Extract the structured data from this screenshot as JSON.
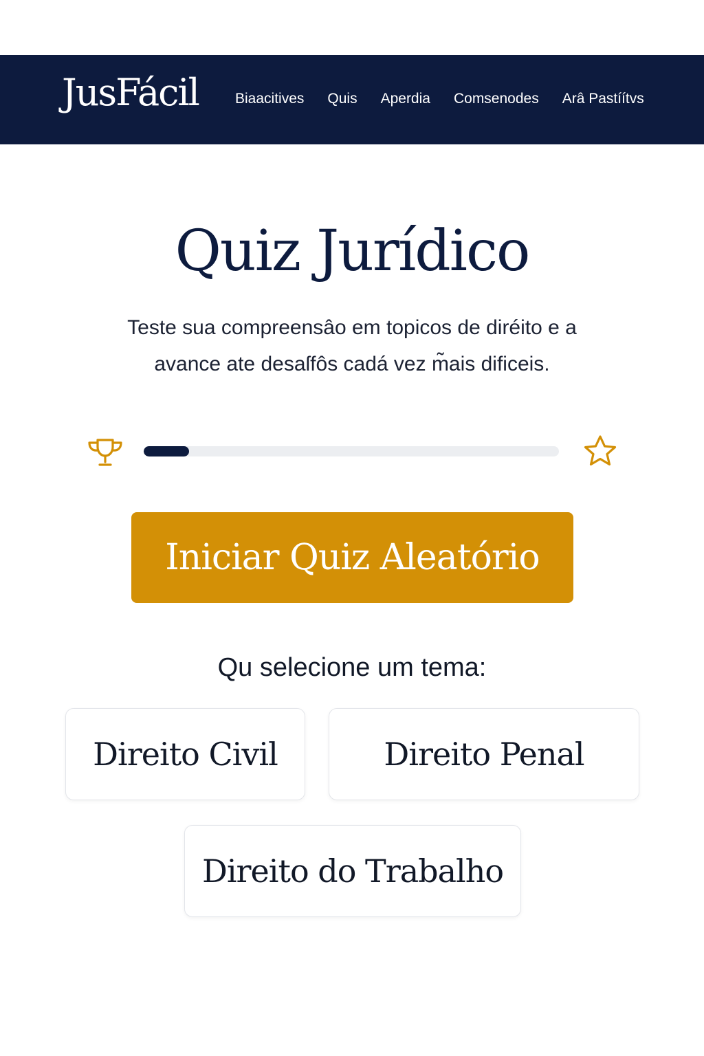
{
  "header": {
    "logo": "JusFácil",
    "nav": [
      {
        "label": "Biaacitives"
      },
      {
        "label": "Quis"
      },
      {
        "label": "Aperdia"
      },
      {
        "label": "Comsenodes"
      },
      {
        "label": "Arâ Pastíítvs"
      }
    ]
  },
  "main": {
    "title": "Quiz Jurídico",
    "subtitle": "Teste sua compreensâo em topicos de diréito e a avance ate desaſfôs cadá vez m̃ais dificeis.",
    "progress": {
      "value_percent": 11,
      "left_icon": "trophy-icon",
      "right_icon": "star-icon"
    },
    "start_button": "Iniciar Quiz Aleatório",
    "select_label": "Qu selecione um tema:",
    "themes": [
      {
        "label": "Direito Civil"
      },
      {
        "label": "Direito Penal"
      },
      {
        "label": "Direito do Trabalho"
      }
    ]
  },
  "colors": {
    "navy": "#0d1b3e",
    "gold": "#d39006"
  }
}
